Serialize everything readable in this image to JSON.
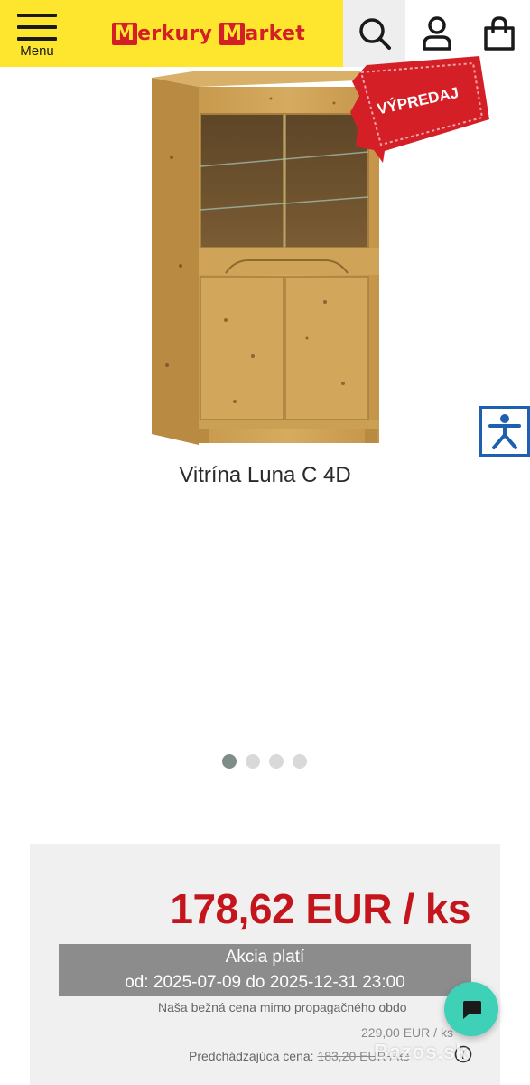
{
  "header": {
    "menu_label": "Menu",
    "logo_text": "MerkuryMarket",
    "logo_first": "erkury",
    "logo_second": "arket"
  },
  "icons": {
    "menu": "hamburger-icon",
    "search": "search-icon",
    "account": "user-icon",
    "cart": "shopping-bag-icon",
    "accessibility": "accessibility-icon",
    "chat": "chat-icon",
    "info": "info-icon"
  },
  "product": {
    "badge": "VÝPREDAJ",
    "title": "Vitrína Luna C 4D",
    "gallery": {
      "count": 4,
      "active": 1
    }
  },
  "pricing": {
    "price": "178,62 EUR / ks",
    "promo_title": "Akcia platí",
    "promo_dates": "od: 2025-07-09 do 2025-12-31 23:00",
    "normal_price_note": "Naša bežná cena mimo propagačného obdo",
    "normal_price": "229,00 EUR / ks",
    "previous_label": "Predchádzajúca cena:",
    "previous_price": "183,20 EUR / ks"
  },
  "watermark": "Bazos.sk",
  "colors": {
    "brand_yellow": "#ffe62e",
    "brand_red": "#d51f26",
    "price_red": "#c4151c",
    "chat_teal": "#3ed1b8"
  }
}
